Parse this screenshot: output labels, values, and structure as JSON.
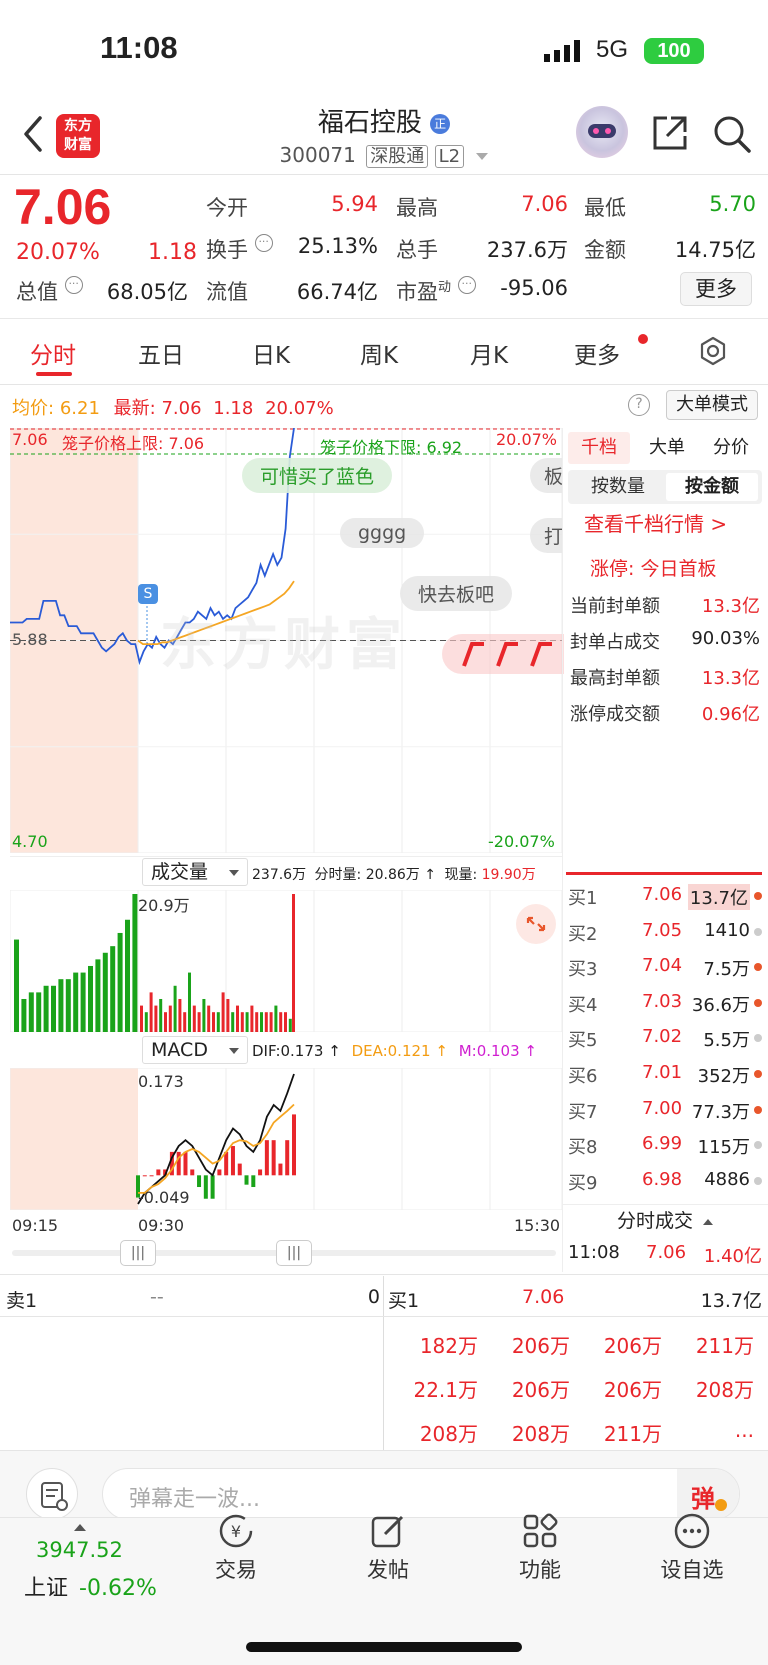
{
  "status_bar": {
    "time": "11:08",
    "network": "5G",
    "battery": "100"
  },
  "header": {
    "title": "福石控股",
    "badge": "正",
    "code": "300071",
    "tag1": "深股通",
    "tag2": "L2",
    "logo_text_line1": "东方",
    "logo_text_line2": "财富"
  },
  "quote": {
    "price": "7.06",
    "change_pct": "20.07%",
    "change": "1.18",
    "labels": {
      "open": "今开",
      "high": "最高",
      "low": "最低",
      "turnover": "换手",
      "volume": "总手",
      "amount": "金额",
      "mktcap": "总值",
      "float_cap": "流值",
      "pe": "市盈",
      "pe_sup": "动"
    },
    "values": {
      "open": "5.94",
      "high": "7.06",
      "low": "5.70",
      "turnover": "25.13%",
      "volume": "237.6万",
      "amount": "14.75亿",
      "mktcap": "68.05亿",
      "float_cap": "66.74亿",
      "pe": "-95.06"
    },
    "more_button": "更多"
  },
  "tabs": [
    "分时",
    "五日",
    "日K",
    "周K",
    "月K",
    "更多"
  ],
  "chart_info": {
    "avg_label": "均价:",
    "avg_value": "6.21",
    "latest_label": "最新:",
    "latest_value": "7.06",
    "latest_change": "1.18",
    "latest_pct": "20.07%",
    "mode_button": "大单模式",
    "top_left": "7.06",
    "upper_limit_text": "笼子价格上限: 7.06",
    "lower_limit_text": "笼子价格下限: 6.92",
    "top_right": "20.07%",
    "mid_left": "5.88",
    "bottom_left": "4.70",
    "bottom_right": "-20.07%",
    "s_marker": "S",
    "danmu": [
      "可惜买了蓝色",
      "gggg",
      "快去板吧",
      "板",
      "打"
    ],
    "watermark": "东方财富"
  },
  "chart_data": [
    {
      "type": "line",
      "title": "分时",
      "x_labels": [
        "09:15",
        "09:30",
        "15:30"
      ],
      "ylim": [
        4.7,
        7.06
      ],
      "ref_price": 5.88,
      "series": [
        {
          "name": "最新",
          "color": "#2a5bd7",
          "values": [
            5.98,
            5.98,
            5.98,
            5.98,
            6.0,
            6.0,
            6.0,
            6.0,
            6.1,
            6.1,
            6.1,
            6.1,
            6.02,
            6.02,
            5.96,
            5.96,
            5.96,
            5.92,
            5.92,
            5.92,
            5.92,
            5.88,
            5.84,
            5.82,
            5.84,
            5.86,
            5.9,
            5.92,
            5.88,
            5.86,
            5.86,
            5.76,
            5.82,
            5.86,
            5.84,
            5.9,
            5.86,
            5.84,
            5.88,
            5.86,
            5.9,
            5.94,
            5.98,
            5.98,
            6.0,
            6.04,
            6.02,
            6.0,
            6.06,
            6.02,
            6.04,
            6.0,
            6.02,
            6.0,
            6.06,
            6.08,
            6.1,
            6.12,
            6.16,
            6.2,
            6.3,
            6.24,
            6.3,
            6.36,
            6.3,
            6.34,
            6.5,
            6.9,
            7.06
          ]
        },
        {
          "name": "均价",
          "color": "#f5a623",
          "values": [
            5.88,
            5.86,
            5.86,
            5.86,
            5.86,
            5.87,
            5.87,
            5.88,
            5.89,
            5.9,
            5.91,
            5.92,
            5.93,
            5.94,
            5.95,
            5.96,
            5.97,
            5.98,
            5.99,
            6.0,
            6.01,
            6.02,
            6.03,
            6.04,
            6.05,
            6.06,
            6.07,
            6.08,
            6.1,
            6.12,
            6.14,
            6.17,
            6.21
          ]
        }
      ]
    },
    {
      "type": "bar",
      "title": "成交量",
      "summary": "237.6万",
      "minute_vol_label": "分时量:",
      "minute_vol": "20.86万",
      "cur_vol_label": "现量:",
      "cur_vol": "19.90万",
      "max_label": "20.9万",
      "values": [
        14,
        5,
        6,
        6,
        7,
        7,
        8,
        8,
        9,
        9,
        10,
        11,
        12,
        13,
        15,
        17,
        20.9,
        4,
        3,
        6,
        4,
        5,
        3,
        4,
        7,
        5,
        3,
        9,
        4,
        3,
        5,
        4,
        3,
        3,
        6,
        5,
        3,
        4,
        3,
        3,
        4,
        3,
        3,
        3,
        3,
        4,
        3,
        3,
        2,
        20.9
      ]
    },
    {
      "type": "line",
      "title": "MACD",
      "dif_label": "DIF:0.173 ↑",
      "dea_label": "DEA:0.121 ↑",
      "m_label": "M:0.103 ↑",
      "top_label": "0.173",
      "bottom_label": "-0.049",
      "series": [
        {
          "name": "DIF",
          "color": "#111111",
          "values": [
            -0.049,
            -0.03,
            -0.02,
            -0.01,
            0.0,
            0.03,
            0.05,
            0.06,
            0.05,
            0.03,
            0.01,
            0.0,
            0.03,
            0.06,
            0.08,
            0.07,
            0.05,
            0.04,
            0.06,
            0.1,
            0.12,
            0.11,
            0.14,
            0.173
          ]
        },
        {
          "name": "DEA",
          "color": "#f5a623",
          "values": [
            -0.03,
            -0.03,
            -0.02,
            -0.015,
            -0.005,
            0.01,
            0.03,
            0.04,
            0.045,
            0.04,
            0.03,
            0.02,
            0.025,
            0.04,
            0.055,
            0.06,
            0.058,
            0.05,
            0.055,
            0.07,
            0.09,
            0.1,
            0.11,
            0.121
          ]
        }
      ]
    }
  ],
  "volume_selector": "成交量",
  "macd_selector": "MACD",
  "axis": {
    "t0": "09:15",
    "t1": "09:30",
    "t2": "15:30"
  },
  "right_panel": {
    "tabs": [
      "千档",
      "大单",
      "分价"
    ],
    "subtabs": [
      "按数量",
      "按金额"
    ],
    "link": "查看千档行情 >",
    "limit_status": "涨停: 今日首板",
    "rows": [
      {
        "label": "当前封单额",
        "value": "13.3亿"
      },
      {
        "label": "封单占成交",
        "value": "90.03%"
      },
      {
        "label": "最高封单额",
        "value": "13.3亿"
      },
      {
        "label": "涨停成交额",
        "value": "0.96亿"
      }
    ],
    "bids": [
      {
        "label": "买1",
        "price": "7.06",
        "vol": "13.7亿"
      },
      {
        "label": "买2",
        "price": "7.05",
        "vol": "1410"
      },
      {
        "label": "买3",
        "price": "7.04",
        "vol": "7.5万"
      },
      {
        "label": "买4",
        "price": "7.03",
        "vol": "36.6万"
      },
      {
        "label": "买5",
        "price": "7.02",
        "vol": "5.5万"
      },
      {
        "label": "买6",
        "price": "7.01",
        "vol": "352万"
      },
      {
        "label": "买7",
        "price": "7.00",
        "vol": "77.3万"
      },
      {
        "label": "买8",
        "price": "6.99",
        "vol": "115万"
      },
      {
        "label": "买9",
        "price": "6.98",
        "vol": "4886"
      }
    ],
    "trades_title": "分时成交",
    "trade": {
      "time": "11:08",
      "price": "7.06",
      "vol": "1.40亿"
    }
  },
  "queue": {
    "sell_label": "卖1",
    "sell_price": "--",
    "sell_vol": "0",
    "buy_label": "买1",
    "buy_price": "7.06",
    "buy_vol": "13.7亿",
    "cells": [
      "182万",
      "206万",
      "206万",
      "211万",
      "22.1万",
      "206万",
      "206万",
      "208万",
      "208万",
      "208万",
      "211万",
      "..."
    ]
  },
  "comment": {
    "placeholder": "弹幕走一波...",
    "danmu_button": "弹"
  },
  "bottom_nav": {
    "index_value": "3947.52",
    "index_label": "上证",
    "index_change": "-0.62%",
    "items": [
      "交易",
      "发帖",
      "功能",
      "设自选"
    ]
  }
}
